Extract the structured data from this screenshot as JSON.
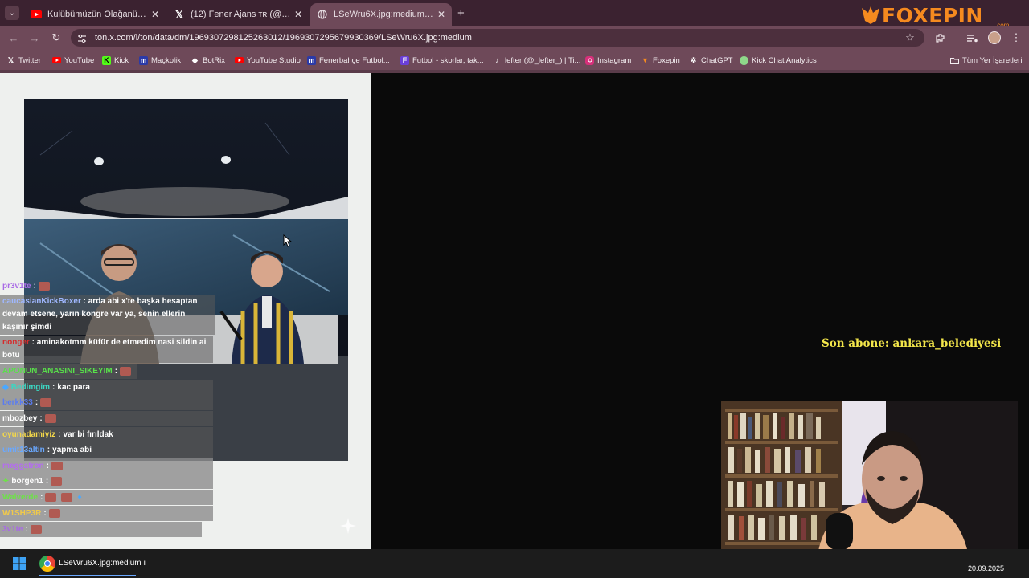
{
  "tabs": [
    {
      "title": "Kulübümüzün Olağanüstü Seçi",
      "icon": "youtube-icon",
      "active": false
    },
    {
      "title": "(12) Fener Ajans ᴛʀ (@ajansfen",
      "icon": "x-icon",
      "active": false
    },
    {
      "title": "LSeWru6X.jpg:medium (796×1(",
      "icon": "globe-icon",
      "active": true
    }
  ],
  "tab_close_glyph": "✕",
  "new_tab_glyph": "+",
  "address_bar": {
    "url": "ton.x.com/i/ton/data/dm/1969307298125263012/1969307295679930369/LSeWru6X.jpg:medium"
  },
  "bookmarks": [
    {
      "label": "Twitter",
      "icon": "x-icon"
    },
    {
      "label": "YouTube",
      "icon": "youtube-icon"
    },
    {
      "label": "Kick",
      "icon": "kick-icon"
    },
    {
      "label": "Maçkolik",
      "icon": "mackolik-icon"
    },
    {
      "label": "BotRix",
      "icon": "botrix-icon"
    },
    {
      "label": "YouTube Studio",
      "icon": "youtube-icon"
    },
    {
      "label": "Fenerbahçe Futbol...",
      "icon": "mackolik-icon"
    },
    {
      "label": "Futbol - skorlar, tak...",
      "icon": "flashscore-icon"
    },
    {
      "label": "lefter (@_lefter_) | Ti...",
      "icon": "tiktok-icon"
    },
    {
      "label": "Instagram",
      "icon": "instagram-icon"
    },
    {
      "label": "Foxepin",
      "icon": "foxepin-icon"
    },
    {
      "label": "ChatGPT",
      "icon": "chatgpt-icon"
    },
    {
      "label": "Kick Chat Analytics",
      "icon": "analytics-icon"
    }
  ],
  "all_bookmarks_label": "Tüm Yer İşaretleri",
  "logo": {
    "text": "FOXEPIN",
    "sub": ".com",
    "color": "#f58a1f"
  },
  "chat": [
    {
      "user": "pr3v1te",
      "user_color": "#a96ae6",
      "text": ""
    },
    {
      "user": "caucasianKickBoxer",
      "user_color": "#9fb7ff",
      "text": "arda abi x'te başka hesaptan devam etsene, yarın kongre var ya, senin ellerin kaşınır şimdi"
    },
    {
      "user": "nonger",
      "user_color": "#d62c2c",
      "text": "aminakotmm küfür de etmedim nasi sildin ai botu"
    },
    {
      "user": "APONUN_ANASINI_SIKEYIM",
      "user_color": "#58e04a",
      "text": ""
    },
    {
      "user": "Bedimgim",
      "user_color": "#3cd6c2",
      "text": "kac para"
    },
    {
      "user": "berkk33",
      "user_color": "#5a7cf0",
      "text": ""
    },
    {
      "user": "mbozbey",
      "user_color": "#ffffff",
      "text": ""
    },
    {
      "user": "oyunadamiyiz",
      "user_color": "#f4d84a",
      "text": "var bi fırıldak"
    },
    {
      "user": "umit13altin",
      "user_color": "#6aa8ff",
      "text": "yapma abi"
    },
    {
      "user": "meggatron",
      "user_color": "#b46cf0",
      "text": ""
    },
    {
      "user": "borgen1",
      "user_color": "#ffffff",
      "text": ""
    },
    {
      "user": "Walverde",
      "user_color": "#6fe04a",
      "text": ""
    },
    {
      "user": "W1SHP3R",
      "user_color": "#f0c94a",
      "text": ""
    },
    {
      "user": "3v1te",
      "user_color": "#a96ae6",
      "text": ""
    }
  ],
  "subscriber": "Son abone: ankara_belediyesi",
  "taskbar": {
    "window_label": "LSeWru6X.jpg:medium ı",
    "date": "20.09.2025"
  }
}
